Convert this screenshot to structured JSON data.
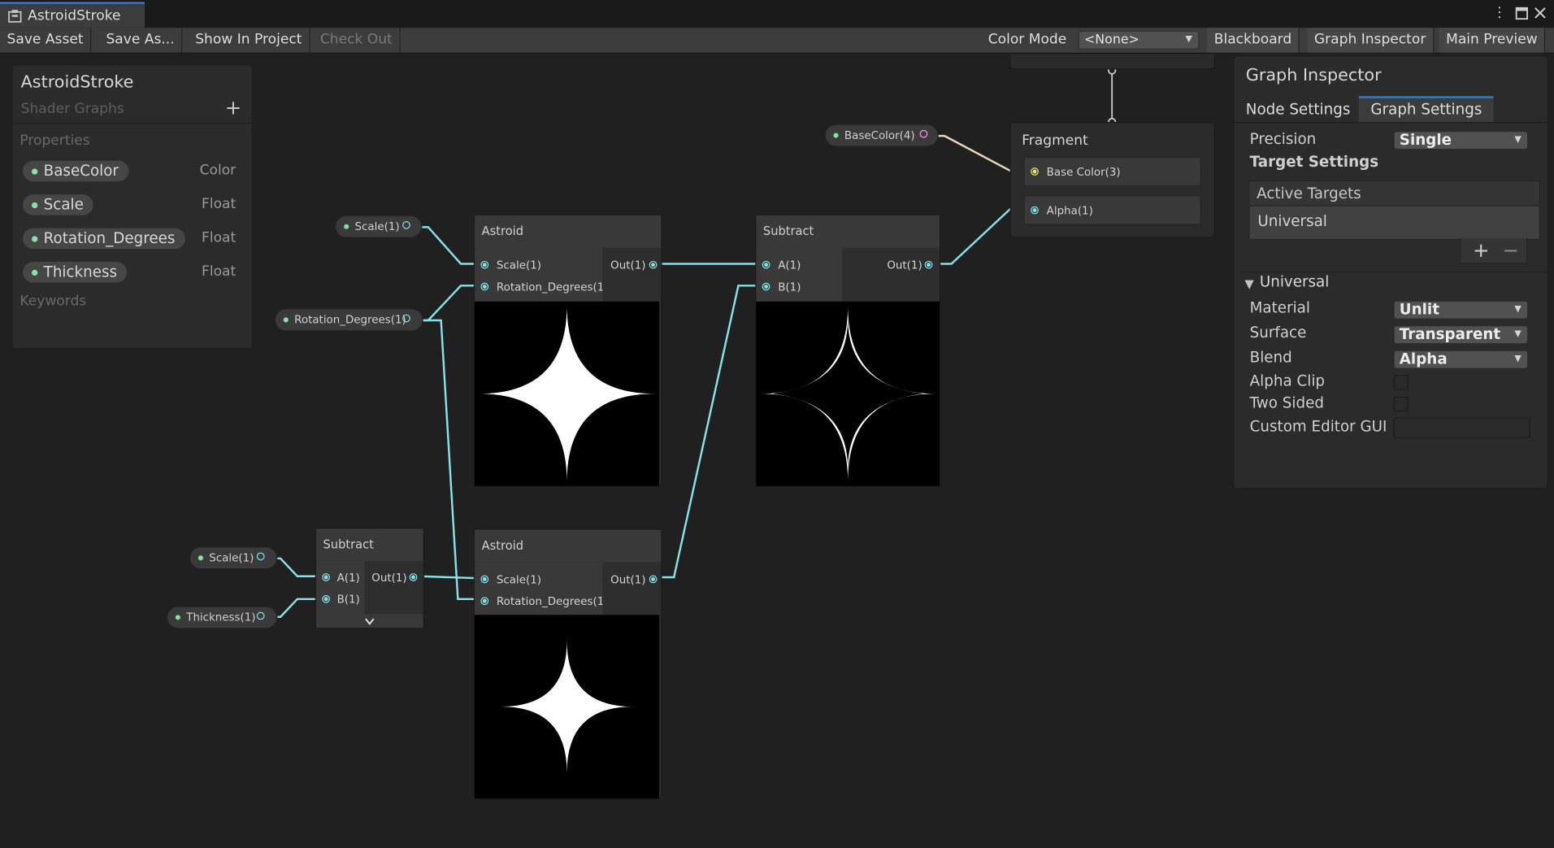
{
  "window": {
    "tab_title": "AstroidStroke"
  },
  "toolbar": {
    "save_asset": "Save Asset",
    "save_as": "Save As...",
    "show_in_project": "Show In Project",
    "check_out": "Check Out",
    "color_mode_label": "Color Mode",
    "color_mode_value": "<None>",
    "blackboard": "Blackboard",
    "graph_inspector": "Graph Inspector",
    "main_preview": "Main Preview"
  },
  "blackboard": {
    "title": "AstroidStroke",
    "subtitle": "Shader Graphs",
    "properties_label": "Properties",
    "properties": [
      {
        "name": "BaseColor",
        "type": "Color"
      },
      {
        "name": "Scale",
        "type": "Float"
      },
      {
        "name": "Rotation_Degrees",
        "type": "Float"
      },
      {
        "name": "Thickness",
        "type": "Float"
      }
    ],
    "keywords_label": "Keywords"
  },
  "graph": {
    "property_nodes": [
      {
        "label": "Scale(1)"
      },
      {
        "label": "Rotation_Degrees(1)"
      },
      {
        "label": "BaseColor(4)"
      },
      {
        "label": "Scale(1)"
      },
      {
        "label": "Thickness(1)"
      }
    ],
    "astroid_top": {
      "title": "Astroid",
      "in1": "Scale(1)",
      "in2": "Rotation_Degrees(1)",
      "out": "Out(1)"
    },
    "astroid_bottom": {
      "title": "Astroid",
      "in1": "Scale(1)",
      "in2": "Rotation_Degrees(1)",
      "out": "Out(1)"
    },
    "subtract_right": {
      "title": "Subtract",
      "in1": "A(1)",
      "in2": "B(1)",
      "out": "Out(1)"
    },
    "subtract_left": {
      "title": "Subtract",
      "in1": "A(1)",
      "in2": "B(1)",
      "out": "Out(1)"
    },
    "fragment": {
      "title": "Fragment",
      "block1": "Base Color(3)",
      "block2": "Alpha(1)"
    }
  },
  "inspector": {
    "title": "Graph Inspector",
    "tabs": [
      "Node Settings",
      "Graph Settings"
    ],
    "active_tab": "Graph Settings",
    "precision_label": "Precision",
    "precision_value": "Single",
    "target_settings_label": "Target Settings",
    "active_targets_label": "Active Targets",
    "active_targets": [
      "Universal"
    ],
    "section_label": "Universal",
    "material_label": "Material",
    "material_value": "Unlit",
    "surface_label": "Surface",
    "surface_value": "Transparent",
    "blend_label": "Blend",
    "blend_value": "Alpha",
    "alpha_clip_label": "Alpha Clip",
    "alpha_clip": false,
    "two_sided_label": "Two Sided",
    "two_sided": false,
    "custom_editor_gui_label": "Custom Editor GUI",
    "custom_editor_gui_value": ""
  },
  "colors": {
    "wire_float": "#84e4e7",
    "wire_color": "#e8d8b8",
    "port_color_vector": "#f1a1e8",
    "property_dot": "#84e4a0",
    "tab_accent": "#3a79bb"
  }
}
